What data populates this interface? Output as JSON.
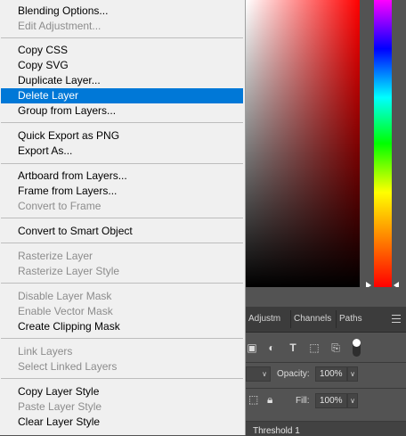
{
  "context_menu": {
    "items": [
      {
        "label": "Blending Options...",
        "enabled": true
      },
      {
        "label": "Edit Adjustment...",
        "enabled": false
      },
      {
        "label": "Copy CSS",
        "enabled": true
      },
      {
        "label": "Copy SVG",
        "enabled": true
      },
      {
        "label": "Duplicate Layer...",
        "enabled": true
      },
      {
        "label": "Delete Layer",
        "enabled": true,
        "highlighted": true
      },
      {
        "label": "Group from Layers...",
        "enabled": true
      },
      {
        "label": "Quick Export as PNG",
        "enabled": true
      },
      {
        "label": "Export As...",
        "enabled": true
      },
      {
        "label": "Artboard from Layers...",
        "enabled": true
      },
      {
        "label": "Frame from Layers...",
        "enabled": true
      },
      {
        "label": "Convert to Frame",
        "enabled": false
      },
      {
        "label": "Convert to Smart Object",
        "enabled": true
      },
      {
        "label": "Rasterize Layer",
        "enabled": false
      },
      {
        "label": "Rasterize Layer Style",
        "enabled": false
      },
      {
        "label": "Disable Layer Mask",
        "enabled": false
      },
      {
        "label": "Enable Vector Mask",
        "enabled": false
      },
      {
        "label": "Create Clipping Mask",
        "enabled": true
      },
      {
        "label": "Link Layers",
        "enabled": false
      },
      {
        "label": "Select Linked Layers",
        "enabled": false
      },
      {
        "label": "Copy Layer Style",
        "enabled": true
      },
      {
        "label": "Paste Layer Style",
        "enabled": false
      },
      {
        "label": "Clear Layer Style",
        "enabled": true
      }
    ],
    "highlight_color": "#0078d7",
    "disabled_color": "#8c8c8c"
  },
  "panel": {
    "tabs": [
      "Adjustm",
      "Channels",
      "Paths"
    ],
    "opacity_label": "Opacity:",
    "opacity_value": "100%",
    "fill_label": "Fill:",
    "fill_value": "100%",
    "layer_name": "Threshold 1"
  },
  "colors": {
    "panel_bg": "#535353",
    "tab_bg": "#3c3c3c",
    "menu_bg": "#f0f0f0"
  }
}
